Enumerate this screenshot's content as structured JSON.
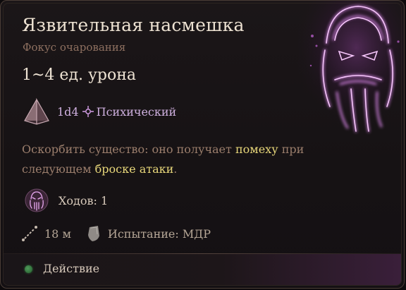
{
  "spell": {
    "title": "Язвительная насмешка",
    "subtitle": "Фокус очарования",
    "damage": "1~4 ед. урона",
    "dice": "1d4",
    "damage_type": "Психический",
    "description": {
      "part1": "Оскорбить существо: оно получает ",
      "kw1": "помеху",
      "part2": " при следующем ",
      "kw2": "броске атаки",
      "part3": "."
    },
    "turns": "Ходов: 1",
    "range": "18 м",
    "save": "Испытание: МДР",
    "action": "Действие"
  },
  "colors": {
    "title": "#ede2d2",
    "subtitle": "#8e7060",
    "damage_type": "#cfb0df",
    "keyword": "#e8d77a",
    "description": "#9b7e6c",
    "action_dot": "#3f8a4a",
    "art_glow": "#d873e8"
  },
  "icons": {
    "spell_art": "vicious-mockery-face-icon",
    "dice": "d4-dice-icon",
    "damage_type": "psychic-icon",
    "turns": "vicious-mockery-mini-icon",
    "range": "range-icon",
    "save": "saving-throw-icon",
    "action": "action-dot-icon"
  }
}
